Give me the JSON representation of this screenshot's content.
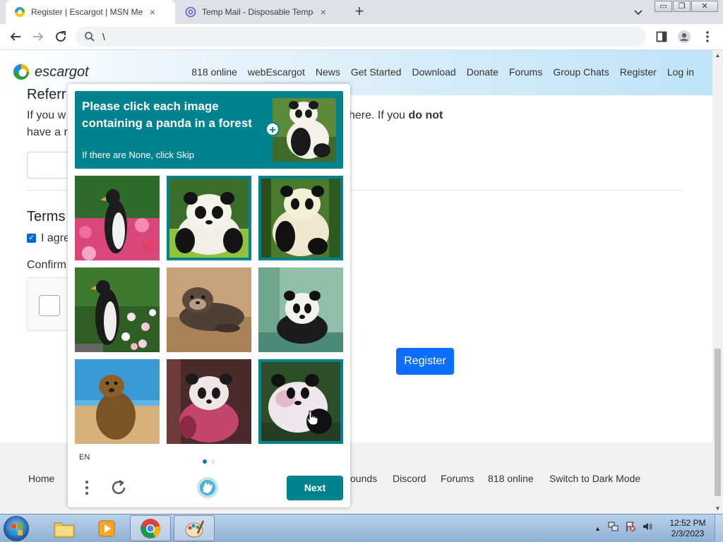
{
  "browser": {
    "tabs": [
      {
        "title": "Register | Escargot | MSN Messe",
        "active": true
      },
      {
        "title": "Temp Mail - Disposable Tempora",
        "active": false
      }
    ],
    "new_tab": "+",
    "close_glyph": "×",
    "window_buttons": [
      "▭",
      "❐",
      "✕"
    ],
    "address": "\\"
  },
  "site": {
    "logo_text": "escargot",
    "nav": [
      "818 online",
      "webEscargot",
      "News",
      "Get Started",
      "Download",
      "Donate",
      "Forums",
      "Group Chats",
      "Register",
      "Log in"
    ],
    "referral_heading": "Referr",
    "referral_line1_left": "If you w",
    "referral_line1_right": "here. If you ",
    "referral_line1_bold": "do not",
    "referral_line2_left": "have a r",
    "terms_heading": "Terms",
    "agree_text": "I agre",
    "confirm_text": "Confirm",
    "register_button": "Register",
    "footer_links": [
      "Home",
      "ounds",
      "Discord",
      "Forums",
      "818 online",
      "Switch to Dark Mode"
    ]
  },
  "captcha": {
    "prompt": "Please click each image containing a panda in a forest",
    "skip_hint": "If there are None, click Skip",
    "plus": "+",
    "tiles": [
      {
        "subject": "penguin-in-flowers",
        "selected": false
      },
      {
        "subject": "panda-on-grass",
        "selected": true
      },
      {
        "subject": "panda-in-forest",
        "selected": true
      },
      {
        "subject": "penguin-in-flowers",
        "selected": false
      },
      {
        "subject": "otter",
        "selected": false
      },
      {
        "subject": "panda-in-water",
        "selected": false
      },
      {
        "subject": "sea-lion-on-beach",
        "selected": false
      },
      {
        "subject": "pink-panda",
        "selected": false
      },
      {
        "subject": "panda-in-forest",
        "selected": true
      }
    ],
    "language": "EN",
    "page_dots": 2,
    "current_page": 1,
    "next_button": "Next",
    "accent": "#00838f"
  },
  "taskbar": {
    "apps": [
      "explorer",
      "media-player",
      "chrome",
      "paint"
    ],
    "time": "12:52 PM",
    "date": "2/3/2023"
  }
}
